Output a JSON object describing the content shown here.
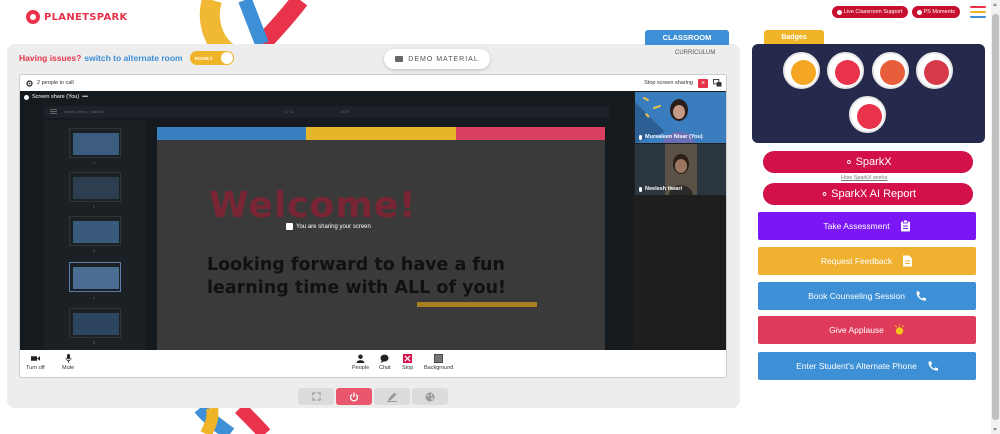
{
  "brand": {
    "logo_text": "PLANETSPARK"
  },
  "header": {
    "live_support_label": "Live Classroom Support",
    "moments_label": "PS Moments",
    "hamburger_colors": [
      "#e8334a",
      "#f0b429",
      "#3d8fd6"
    ]
  },
  "room": {
    "issues_text": "Having issues?",
    "switch_text": "switch to alternate room",
    "toggle_label": "ROOM 2",
    "demo_material_label": "DEMO MATERIAL",
    "classroom_tab": "CLASSROOM",
    "curriculum_label": "CURRICULUM"
  },
  "call": {
    "people_count": "2 people in call",
    "stop_sharing_label": "Stop screen sharing",
    "share_label": "Screen share (You)",
    "sharing_note": "You are sharing your screen",
    "ppt_filename": "senior_demo_+panel4",
    "ppt_page": "1 / 11",
    "ppt_zoom": "60%",
    "slide": {
      "title": "Welcome!",
      "line1": "Looking forward to have a fun",
      "line2": "learning time with ALL of you!",
      "bar_colors": [
        "#3a7fc0",
        "#e6b62a",
        "#d94060"
      ]
    },
    "thumb_numbers": [
      "1",
      "2",
      "3",
      "4",
      "5"
    ],
    "participants": [
      {
        "name": "Mursaleen Nisar (You)"
      },
      {
        "name": "Neelesh tiwari"
      }
    ],
    "controls": {
      "camera": "Turn off",
      "mic": "Mute",
      "people": "People",
      "chat": "Chat",
      "stop": "Stop",
      "background": "Background"
    }
  },
  "badges": {
    "tab_label": "Badges",
    "colors": [
      "#f5a623",
      "#e8334a",
      "#e85d3a",
      "#d63a4a",
      "#e8334a"
    ]
  },
  "sparkx": {
    "button_label": "SparkX",
    "how_link": "How SparkX works",
    "report_label": "SparkX AI Report"
  },
  "actions": [
    {
      "label": "Take Assessment",
      "color": "#7b16f5"
    },
    {
      "label": "Request Feedback",
      "color": "#f0b030"
    },
    {
      "label": "Book Counseling Session",
      "color": "#3d8fd6"
    },
    {
      "label": "Give Applause",
      "color": "#de3a5a"
    },
    {
      "label": "Enter Student's Alternate Phone",
      "color": "#3d8fd6"
    }
  ]
}
